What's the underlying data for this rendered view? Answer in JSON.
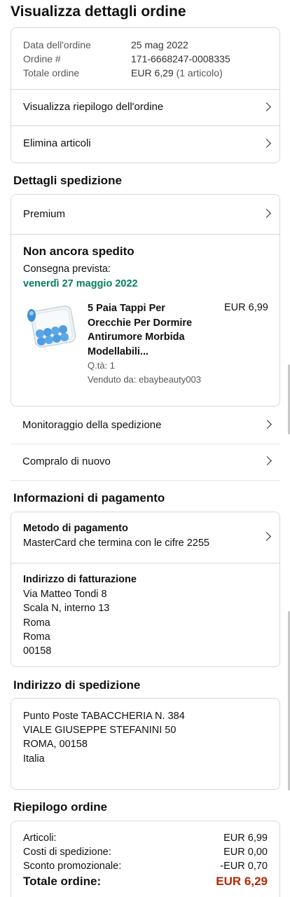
{
  "page": {
    "title": "Visualizza dettagli ordine"
  },
  "order_info": {
    "date_label": "Data dell'ordine",
    "date_value": "25 mag 2022",
    "order_label": "Ordine #",
    "order_value": "171-6668247-0008335",
    "total_label": "Totale ordine",
    "total_value": "EUR 6,29",
    "total_items": "(1 articolo)",
    "summary_link": "Visualizza riepilogo dell'ordine",
    "delete_link": "Elimina articoli"
  },
  "shipping": {
    "section_title": "Dettagli spedizione",
    "premium_label": "Premium",
    "status": "Non ancora spedito",
    "delivery_label": "Consegna prevista:",
    "delivery_date": "venerdì 27 maggio 2022",
    "item": {
      "title_line1": "5 Paia Tappi Per",
      "title_line2": "Orecchie Per Dormire",
      "title_line3": "Antirumore Morbida",
      "title_line4": "Modellabili...",
      "price": "EUR 6,99",
      "qty": "Q.tà: 1",
      "seller": "Venduto da: ebaybeauty003"
    },
    "track_link": "Monitoraggio della spedizione",
    "buy_again_link": "Compralo di nuovo"
  },
  "payment": {
    "section_title": "Informazioni di pagamento",
    "method_title": "Metodo di pagamento",
    "method_value": "MasterCard che termina con le cifre 2255",
    "billing_title": "Indirizzo di fatturazione",
    "billing_lines": [
      "Via Matteo Tondi 8",
      "Scala N, interno 13",
      "Roma",
      "Roma",
      "00158"
    ]
  },
  "delivery_address": {
    "section_title": "Indirizzo di spedizione",
    "lines": [
      "Punto Poste TABACCHERIA N. 384",
      "VIALE GIUSEPPE STEFANINI 50",
      "ROMA, 00158",
      "Italia"
    ]
  },
  "summary": {
    "section_title": "Riepilogo ordine",
    "rows": [
      {
        "label": "Articoli:",
        "value": "EUR 6,99"
      },
      {
        "label": "Costi di spedizione:",
        "value": "EUR 0,00"
      },
      {
        "label": "Sconto promozionale:",
        "value": "-EUR 0,70"
      }
    ],
    "total_label": "Totale ordine:",
    "total_value": "EUR 6,29"
  },
  "colors": {
    "green": "#067d62",
    "price_red": "#b12704",
    "border": "#d5d9d9"
  },
  "icons": [
    "chevron-right-icon",
    "earplug-product-image"
  ]
}
